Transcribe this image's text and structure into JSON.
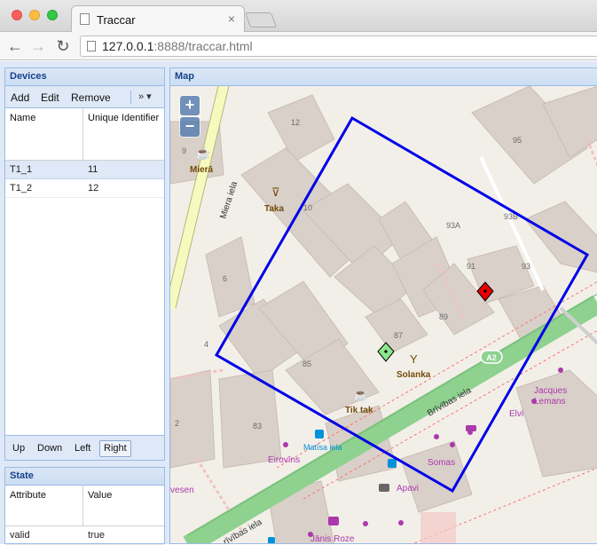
{
  "browser": {
    "tab_title": "Traccar",
    "tab_close": "×",
    "url_host": "127.0.0.1",
    "url_rest": ":8888/traccar.html",
    "back_icon": "←",
    "forward_icon": "→",
    "reload_icon": "↻"
  },
  "devices": {
    "title": "Devices",
    "toolbar": {
      "add": "Add",
      "edit": "Edit",
      "remove": "Remove",
      "more": "»"
    },
    "columns": [
      "Name",
      "Unique Identifier"
    ],
    "rows": [
      {
        "name": "T1_1",
        "uid": "11",
        "selected": true
      },
      {
        "name": "T1_2",
        "uid": "12",
        "selected": false
      }
    ],
    "bottom": {
      "up": "Up",
      "down": "Down",
      "left": "Left",
      "right": "Right",
      "active": "Right"
    }
  },
  "state": {
    "title": "State",
    "columns": [
      "Attribute",
      "Value"
    ],
    "rows": [
      {
        "attribute": "valid",
        "value": "true"
      }
    ]
  },
  "map": {
    "title": "Map",
    "zoom_in": "+",
    "zoom_out": "−",
    "labels": {
      "n12": "12",
      "n9": "9",
      "n10": "10",
      "n6": "6",
      "n4": "4",
      "n2": "2",
      "n95": "95",
      "n93a": "93A",
      "n93b": "93B",
      "n91": "91",
      "n93": "93",
      "n89": "89",
      "n87": "87",
      "n85": "85",
      "n83": "83",
      "miera": "Mierā",
      "taka": "Taka",
      "solanka": "Solanka",
      "tiktak": "Tik tak",
      "street_miera": "Miera iela",
      "street_brivibas": "Brīvības iela",
      "street_brivibas2": "rīvības iela",
      "a2": "A2",
      "matisa": "Matīsa iela",
      "eirovins": "Eirovīns",
      "somas": "Somas",
      "apavi": "Apavi",
      "elvi": "Elvi",
      "jacques": "Jacques",
      "lemans": "Lemans",
      "janis": "Jānis Roze",
      "vesen": "vesen"
    },
    "colors": {
      "fence": "#0000e6",
      "marker_red": "#e60000",
      "marker_green": "#8ce68c",
      "road": "#8fd18f"
    }
  }
}
